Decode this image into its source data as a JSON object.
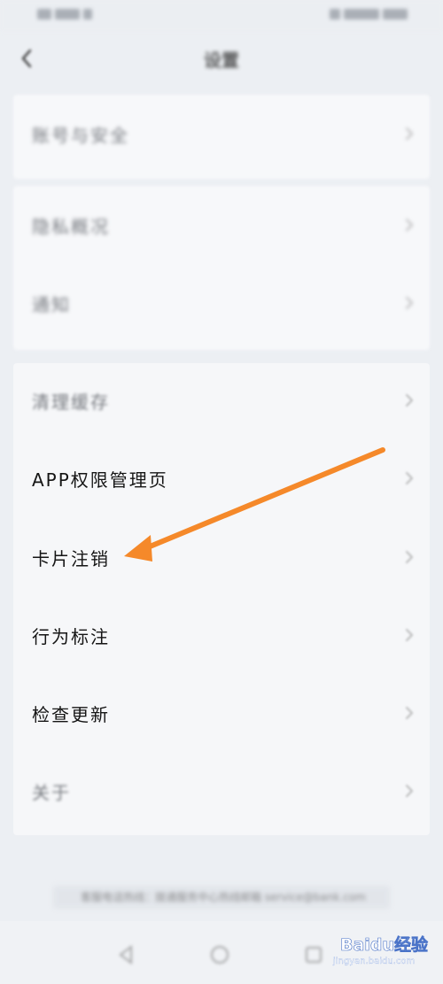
{
  "header": {
    "title": "设置"
  },
  "cards": {
    "card1": [
      {
        "label": "账号与安全"
      }
    ],
    "card2": [
      {
        "label": "隐私概况"
      },
      {
        "label": "通知"
      }
    ],
    "card3": [
      {
        "label": "清理缓存"
      },
      {
        "label": "APP权限管理页"
      },
      {
        "label": "卡片注销"
      },
      {
        "label": "行为标注"
      },
      {
        "label": "检查更新"
      },
      {
        "label": "关于"
      }
    ]
  },
  "footer": {
    "text": "客服电话热线：拨通服务中心热线邮箱 service@bank.com"
  },
  "watermark": {
    "logo": "Baidu经验",
    "url": "jingyan.baidu.com"
  },
  "colors": {
    "arrow": "#f5892a",
    "background": "#eceff3",
    "card": "#f7f8fa"
  }
}
